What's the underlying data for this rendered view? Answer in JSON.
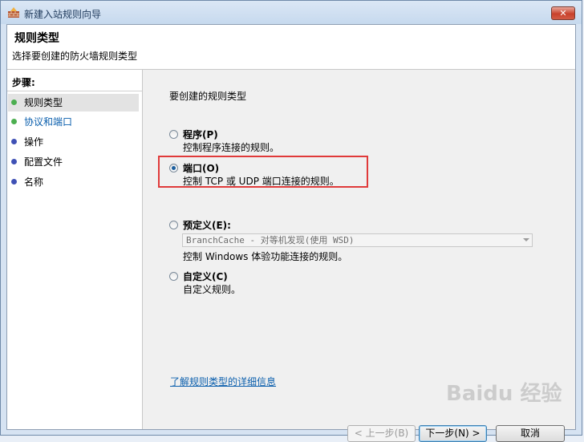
{
  "window": {
    "title": "新建入站规则向导",
    "close_label": "✕"
  },
  "header": {
    "title": "规则类型",
    "subtitle": "选择要创建的防火墙规则类型"
  },
  "steps": {
    "heading": "步骤:",
    "items": [
      {
        "label": "规则类型",
        "color": "#4caf50",
        "current": true
      },
      {
        "label": "协议和端口",
        "color": "#4caf50",
        "current": false
      },
      {
        "label": "操作",
        "color": "#3f51b5",
        "current": false
      },
      {
        "label": "配置文件",
        "color": "#3f51b5",
        "current": false
      },
      {
        "label": "名称",
        "color": "#3f51b5",
        "current": false
      }
    ]
  },
  "main": {
    "prompt": "要创建的规则类型",
    "options": [
      {
        "label": "程序(P)",
        "desc": "控制程序连接的规则。",
        "checked": false
      },
      {
        "label": "端口(O)",
        "desc": "控制 TCP 或 UDP 端口连接的规则。",
        "checked": true
      },
      {
        "label": "预定义(E):",
        "desc": "控制 Windows 体验功能连接的规则。",
        "checked": false
      },
      {
        "label": "自定义(C)",
        "desc": "自定义规则。",
        "checked": false
      }
    ],
    "predefined_select": "BranchCache - 对等机发现(使用 WSD)",
    "learn_more_link": "了解规则类型的详细信息"
  },
  "buttons": {
    "back": "< 上一步(B)",
    "next": "下一步(N) >",
    "cancel": "取消"
  },
  "watermark": "Baidu 经验"
}
